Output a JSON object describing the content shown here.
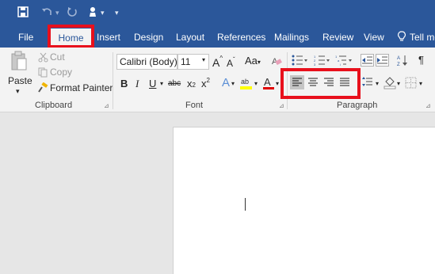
{
  "tabs": [
    "File",
    "Home",
    "Insert",
    "Design",
    "Layout",
    "References",
    "Mailings",
    "Review",
    "View",
    "Tell me"
  ],
  "clipboard": {
    "paste": "Paste",
    "cut": "Cut",
    "copy": "Copy",
    "format_painter": "Format Painter",
    "label": "Clipboard"
  },
  "font": {
    "name": "Calibri (Body)",
    "size": "11",
    "label": "Font"
  },
  "paragraph": {
    "label": "Paragraph"
  },
  "colors": {
    "brand": "#2b579a",
    "highlight": "#e8101c"
  }
}
